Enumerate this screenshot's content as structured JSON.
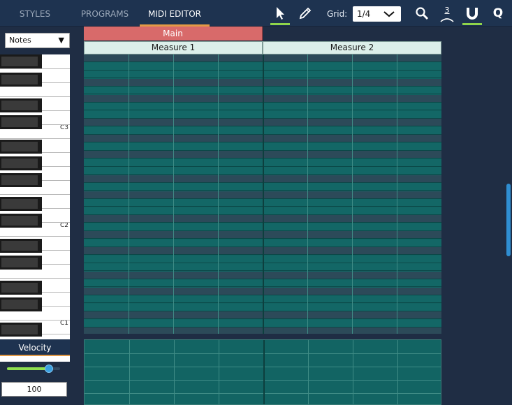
{
  "header": {
    "tabs": [
      {
        "label": "STYLES",
        "active": false
      },
      {
        "label": "PROGRAMS",
        "active": false
      },
      {
        "label": "MIDI EDITOR",
        "active": true
      }
    ],
    "grid_label": "Grid:",
    "grid_value": "1/4",
    "triplet_label": "3",
    "quantize_label": "Q",
    "tools": [
      "pointer-icon",
      "pencil-icon",
      "zoom-icon",
      "triplet-icon",
      "magnet-icon",
      "quantize-icon"
    ]
  },
  "left_panel": {
    "notes_select": "Notes",
    "octave_labels": [
      "C3",
      "C2",
      "C1"
    ]
  },
  "timeline": {
    "section": "Main",
    "measures": [
      "Measure 1",
      "Measure 2"
    ]
  },
  "velocity": {
    "header": "Velocity",
    "value": "100",
    "slider_level": 0.79
  },
  "colors": {
    "accent_orange": "#e39a46",
    "accent_green": "#8fd44a",
    "section_red": "#d86a6a",
    "grid_teal": "#126463"
  }
}
